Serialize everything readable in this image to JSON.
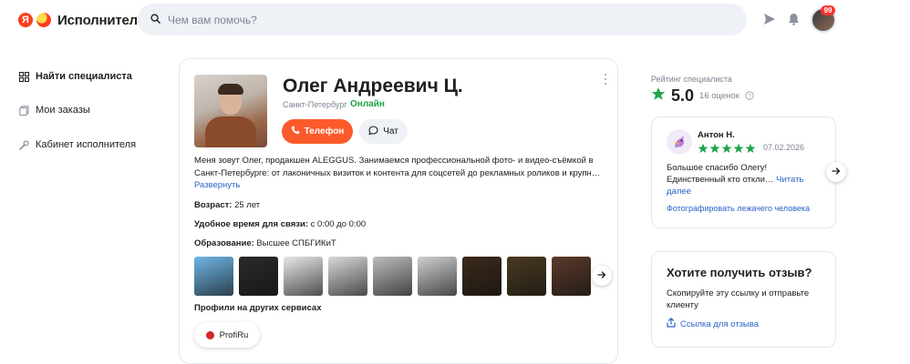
{
  "header": {
    "logo_ya": "Я",
    "logo_text": "Исполнители",
    "search_placeholder": "Чем вам помочь?",
    "notification_badge": "99",
    "icons": [
      "search-icon",
      "send-icon",
      "bell-icon"
    ]
  },
  "sidebar": {
    "items": [
      {
        "label": "Найти специалиста",
        "icon": "grid-icon",
        "active": true
      },
      {
        "label": "Мои заказы",
        "icon": "orders-icon",
        "active": false
      },
      {
        "label": "Кабинет исполнителя",
        "icon": "wrench-icon",
        "active": false
      }
    ]
  },
  "profile": {
    "name": "Олег Андреевич Ц.",
    "city": "Санкт-Петербург",
    "separator": "·",
    "status": "Онлайн",
    "phone_label": "Телефон",
    "chat_label": "Чат",
    "about": "Меня зовут Олег, продакшен ALEGGUS. Занимаемся профессиональной фото- и видео-съёмкой в Санкт-Петербурге: от лаконичных визиток и контента для соцсетей до рекламных роликов и крупн…",
    "about_more": "Развернуть",
    "age_label": "Возраст:",
    "age_value": "25 лет",
    "time_label": "Удобное время для связи:",
    "time_value": "с 0:00 до 0:00",
    "edu_label": "Образование:",
    "edu_value": "Высшее СПБГИКиТ",
    "profiles_heading": "Профили на других сервисах",
    "profi_label": "ProfiRu",
    "thumb_colors": [
      "#6fb6e6",
      "#2a2a2a",
      "#e8e8e8",
      "#d9d9d9",
      "#bdbdbd",
      "#cfcfcf",
      "#3b2a1a",
      "#4a3a20",
      "#5a3a2a"
    ]
  },
  "rating": {
    "label": "Рейтинг специалиста",
    "value": "5.0",
    "count": "16 оценок",
    "star_color": "#1fa44a"
  },
  "review": {
    "author": "Антон Н.",
    "stars": 5,
    "date": "07.02.2026",
    "text": "Большое спасибо Олегу! Единственный кто откли…",
    "more": "Читать далее",
    "tag": "Фотографировать лежачего человека"
  },
  "feedback": {
    "title": "Хотите получить отзыв?",
    "subtitle": "Скопируйте эту ссылку и отправьте клиенту",
    "link": "Ссылка для отзыва"
  }
}
